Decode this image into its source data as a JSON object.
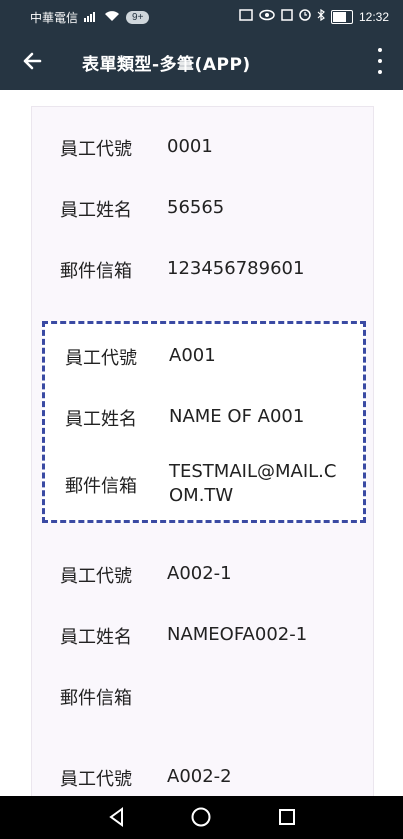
{
  "status_bar": {
    "carrier": "中華電信",
    "badge": "9+",
    "battery": "64",
    "time": "12:32"
  },
  "toolbar": {
    "title": "表單類型-多筆(APP)"
  },
  "form": {
    "record_1": [
      {
        "label": "員工代號",
        "value": "0001"
      },
      {
        "label": "員工姓名",
        "value": "56565"
      },
      {
        "label": "郵件信箱",
        "value": "123456789601"
      }
    ],
    "record_2": [
      {
        "label": "員工代號",
        "value": "A001"
      },
      {
        "label": "員工姓名",
        "value": "NAME OF A001"
      },
      {
        "label": "郵件信箱",
        "value": "TESTMAIL@MAIL.COM.TW"
      }
    ],
    "record_3": [
      {
        "label": "員工代號",
        "value": "A002-1"
      },
      {
        "label": "員工姓名",
        "value": "NAMEOFA002-1"
      },
      {
        "label": "郵件信箱",
        "value": ""
      }
    ],
    "record_4": [
      {
        "label": "員工代號",
        "value": "A002-2"
      }
    ]
  },
  "colors": {
    "appbar": "#263542",
    "selection_border": "#3a4aa3",
    "card_background": "#faf7fc"
  }
}
